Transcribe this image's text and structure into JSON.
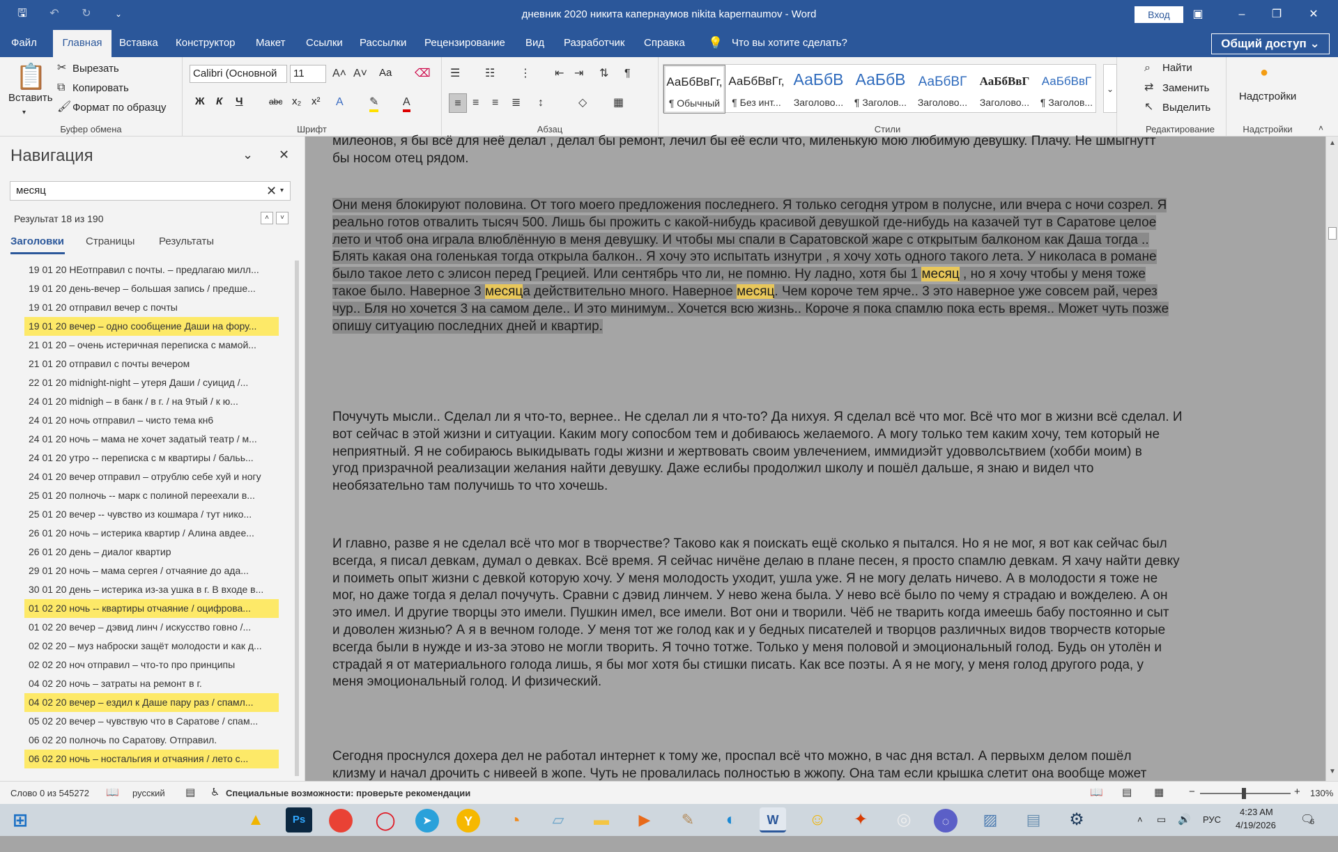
{
  "window": {
    "title": "дневник 2020 никита капернаумов nikita kapernaumov  -  Word",
    "signin": "Вход"
  },
  "menu": {
    "tabs": [
      "Файл",
      "Главная",
      "Вставка",
      "Конструктор",
      "Макет",
      "Ссылки",
      "Рассылки",
      "Рецензирование",
      "Вид",
      "Разработчик",
      "Справка"
    ],
    "tellme": "Что вы хотите сделать?",
    "share": "Общий доступ"
  },
  "ribbon": {
    "clipboard": {
      "paste": "Вставить",
      "cut": "Вырезать",
      "copy": "Копировать",
      "format_painter": "Формат по образцу",
      "label": "Буфер обмена"
    },
    "font": {
      "name": "Calibri (Основной",
      "size": "11",
      "label": "Шрифт",
      "bold": "Ж",
      "italic": "К",
      "underline": "Ч",
      "strike": "abc",
      "sub": "x₂",
      "sup": "x²",
      "case": "Aa"
    },
    "paragraph": {
      "label": "Абзац"
    },
    "styles": {
      "label": "Стили",
      "items": [
        {
          "preview": "АаБбВвГг,",
          "name": "¶ Обычный"
        },
        {
          "preview": "АаБбВвГг,",
          "name": "¶ Без инт..."
        },
        {
          "preview": "АаБбВ",
          "name": "Заголово..."
        },
        {
          "preview": "АаБбВ",
          "name": "¶ Заголов..."
        },
        {
          "preview": "АаБбВГ",
          "name": "Заголово..."
        },
        {
          "preview": "АаБбВвГ",
          "name": "Заголово..."
        },
        {
          "preview": "АаБбВвГ",
          "name": "¶ Заголов..."
        }
      ]
    },
    "editing": {
      "find": "Найти",
      "replace": "Заменить",
      "select": "Выделить",
      "label": "Редактирование"
    },
    "addins": {
      "button": "Надстройки",
      "label": "Надстройки"
    }
  },
  "nav": {
    "title": "Навигация",
    "search_value": "месяц",
    "result_count": "Результат 18 из 190",
    "tabs": [
      "Заголовки",
      "Страницы",
      "Результаты"
    ],
    "headings": [
      {
        "text": "19 01 20 НЕотправил с почты. – предлагаю милл...",
        "hl": false
      },
      {
        "text": "19 01 20 день-вечер – большая запись  /  предше...",
        "hl": false
      },
      {
        "text": "19 01 20 отправил вечер с почты",
        "hl": false
      },
      {
        "text": "19 01 20 вечер – одно сообщение Даши на фору...",
        "hl": true
      },
      {
        "text": "21 01 20 – очень истеричная переписка с мамой...",
        "hl": false
      },
      {
        "text": "21 01 20 отправил с почты вечером",
        "hl": false
      },
      {
        "text": "22 01 20 midnight-night – утеря Даши  /  суицид  /...",
        "hl": false
      },
      {
        "text": "24 01 20 midnigh – в банк  /  в г.   /  на 9тый  /  к ю...",
        "hl": false
      },
      {
        "text": "24 01 20 ночь отправил – чисто тема кн6",
        "hl": false
      },
      {
        "text": "24 01 20 ночь – мама не хочет задатый театр  /  м...",
        "hl": false
      },
      {
        "text": "24 01 20 утро -- переписка с м квартиры  /  бальь...",
        "hl": false
      },
      {
        "text": "24 01 20 вечер отправил – отрублю себе хуй и ногу",
        "hl": false
      },
      {
        "text": "25 01 20 полночь -- марк с полиной переехали в...",
        "hl": false
      },
      {
        "text": "25 01 20 вечер -- чувство из кошмара  /  тут нико...",
        "hl": false
      },
      {
        "text": "26 01 20 ночь – истерика квартир  /  Алина авдее...",
        "hl": false
      },
      {
        "text": "26 01 20 день – диалог квартир",
        "hl": false
      },
      {
        "text": "29 01 20  ночь – мама сергея  /  отчаяние до ада...",
        "hl": false
      },
      {
        "text": "30 01 20 день – истерика из-за ушка в г. В входе в...",
        "hl": false
      },
      {
        "text": "01 02 20 ночь -- квартиры отчаяние  /  оцифрова...",
        "hl": true
      },
      {
        "text": "01 02 20 вечер – дэвид линч  /  искусство говно  /...",
        "hl": false
      },
      {
        "text": "02 02 20 – муз наброски защёт молодости и как д...",
        "hl": false
      },
      {
        "text": "02 02 20 ноч отправил – что-то про принципы",
        "hl": false
      },
      {
        "text": "04 02 20 ночь – затраты на ремонт в г.",
        "hl": false
      },
      {
        "text": "04 02 20 вечер – ездил к Даше пару раз  /  спамл...",
        "hl": true
      },
      {
        "text": "05 02 20 вечер – чувствую что в Саратове  /  спам...",
        "hl": false
      },
      {
        "text": "06 02 20  полночь по Саратову. Отправил.",
        "hl": false
      },
      {
        "text": "06 02 20 ночь – ностальгия и отчаяния  /  лето с...",
        "hl": true
      }
    ]
  },
  "document": {
    "p0": [
      "милеонов, я бы всё для неё делал , делал бы ремонт, лечил бы её если что, миленькую мою любимую девушку. Плачу. Не шмыгнутт",
      "бы носом отец рядом."
    ],
    "p1": [
      "Они меня блокируют половина. От того моего предложения последнего. Я только сегодня утром в полусне, или вчера с ночи созрел. Я",
      "реально готов отвалить тысяч 500. Лишь бы прожить с какой-нибудь красивой девушкой где-нибудь на казачей тут в Саратове целое",
      "лето и чтоб она играла влюблённую в меня девушку. И чтобы мы спали в Саратовской жаре с открытым балконом как Даша тогда ..",
      "Блять какая она голенькая тогда открыла балкон.. Я хочу это испытать изнутри ,  я хочу хоть одного такого лета. У николаса в романе",
      [
        "было такое лето с элисон перед Грецией. Или сентябрь что ли, не помню. Ну ладно, хотя бы 1 ",
        "месяц",
        " , но я хочу чтобы у меня тоже"
      ],
      [
        "такое было. Наверное 3 ",
        "месяц",
        "а действительно много. Наверное ",
        "месяц",
        ". Чем короче тем ярче.. 3 это наверное уже совсем рай, через"
      ],
      "чур.. Бля но хочется 3 на самом деле.. И это минимум.. Хочется всю жизнь.. Короче я пока спамлю пока есть время.. Может чуть позже",
      "опишу ситуацию последних дней и квартир. "
    ],
    "p2": [
      "Почучуть мысли.. Сделал ли я что-то, вернее.. Не сделал ли я что-то? Да нихуя. Я сделал всё что мог. Всё что мог в жизни всё сделал.  И",
      "вот сейчас в этой жизни и ситуации. Каким могу сопосбом тем и добиваюсь желаемого.  А могу только тем каким хочу, тем который не",
      "неприятный. Я не собираюсь выкидывать годы жизни и жертвовать своим увлечением, иммидиэйт удовволсьтвием (хобби моим) в",
      "угод призрачной реализации желания найти девушку. Даже еслибы продолжил школу и пошёл дальше, я знаю и видел что",
      "необязательно там получишь то что хочешь."
    ],
    "p3": [
      "И главно, разве я не сделал всё что мог в творчестве? Таково как я поискать ещё сколько я пытался. Но я не мог, я вот как сейчас был",
      "всегда, я писал девкам, думал о девках. Всё время. Я сейчас ничёне делаю в плане песен, я просто спамлю девкам. Я хачу найти девку",
      "и поиметь опыт жизни с девкой которую хочу. У меня молодость уходит, ушла уже. Я не могу делать ничево. А в молодости я тоже не",
      "мог, но даже тогда я делал почучуть. Сравни с дэвид линчем. У нево жена была. У нево всё было по чему я страдаю и вожделею. А он",
      "это имел. И другие творцы это имели. Пушкин имел, все имели. Вот они и творили. Чёб не тварить когда имеешь бабу постоянно и сыт",
      "и доволен жизнью? А я в вечном голоде. У меня тот же голод как и у бедных писателей и творцов различных видов творчеств которые",
      "всегда были в нужде и из-за этово не могли творить. Я точно тотже. Только у меня половой и эмоциональный голод. Будь он утолён и",
      "страдай я от материального голода лишь, я бы мог хотя бы стишки писать. Как все поэты. А я не могу, у меня голод другого рода, у",
      "меня эмоциональный голод. И физический."
    ],
    "p4": [
      "Сегодня проснулся дохера дел не работал интернет к тому же, проспал всё что можно, в час дня встал. А первыхм делом пошёл",
      "клизму и начал дрочить с нивеей в жопе. Чуть не провалилась полностью в жжопу. Она там если крышка слетит она вообще может"
    ]
  },
  "status": {
    "words": "Слово 0 из 545272",
    "lang": "русский",
    "accessibility": "Специальные возможности: проверьте рекомендации",
    "zoom": "130%"
  },
  "taskbar": {
    "lang": "РУС",
    "time": "4:23 AM",
    "date": "4/19/2026",
    "notif": "6"
  },
  "colors": {
    "word_blue": "#2b579a",
    "highlight": "#fde968",
    "hit": "#e8c75a"
  }
}
